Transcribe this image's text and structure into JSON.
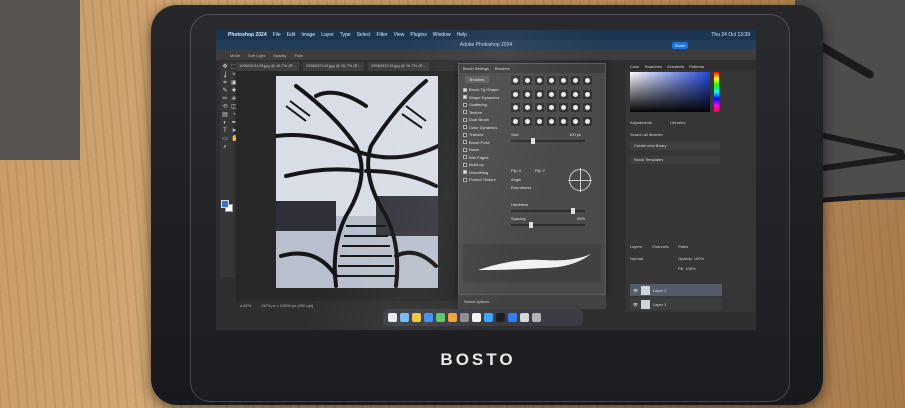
{
  "tablet": {
    "brand": "BOSTO"
  },
  "menubar": {
    "items": [
      "Photoshop 2024",
      "File",
      "Edit",
      "Image",
      "Layer",
      "Type",
      "Select",
      "Filter",
      "View",
      "Plugins",
      "Window",
      "Help"
    ],
    "clock": "Thu 24 Oct 13:39"
  },
  "window": {
    "title": "Adobe Photoshop 2024",
    "share_label": "Share"
  },
  "options_bar": {
    "mode_label": "Mode",
    "mode_value": "Soft Light",
    "opacity_label": "Opacity",
    "flow_label": "Flow"
  },
  "documents": {
    "tabs": [
      "19960321143.jpg @ 16.7% (R...",
      "1996032143.jpg @ 16.7% (R...",
      "1996032143.jpg @ 16.7% (R..."
    ]
  },
  "status": {
    "zoom": "4.82%",
    "info": "2673 px x 13000 px (300 ppi)"
  },
  "brush_settings": {
    "tabs": [
      "Brush Settings",
      "Brushes"
    ],
    "subtab": "Brushes",
    "options": [
      {
        "label": "Brush Tip Shape",
        "on": true
      },
      {
        "label": "Shape Dynamics",
        "on": true
      },
      {
        "label": "Scattering",
        "on": false
      },
      {
        "label": "Texture",
        "on": false
      },
      {
        "label": "Dual Brush",
        "on": false
      },
      {
        "label": "Color Dynamics",
        "on": false
      },
      {
        "label": "Transfer",
        "on": false
      },
      {
        "label": "Brush Pose",
        "on": false
      },
      {
        "label": "Noise",
        "on": false
      },
      {
        "label": "Wet Edges",
        "on": false
      },
      {
        "label": "Build-up",
        "on": false
      },
      {
        "label": "Smoothing",
        "on": true
      },
      {
        "label": "Protect Texture",
        "on": false
      }
    ],
    "size": "100 px",
    "flip_x": "Flip X",
    "flip_y": "Flip Y",
    "angle_label": "Angle",
    "roundness_label": "Roundness",
    "hardness_label": "Hardness",
    "spacing_label": "Spacing",
    "spacing_value": "25%",
    "footer": "Select options"
  },
  "right_panel": {
    "tabs": [
      "Color",
      "Swatches",
      "Gradients",
      "Patterns"
    ],
    "adj_tabs": [
      "Adjustments",
      "Libraries"
    ],
    "search_placeholder": "Search all libraries",
    "create_label": "Create new library",
    "stock_label": "Stock Templates",
    "layers_tabs": [
      "Layers",
      "Channels",
      "Paths"
    ],
    "kind_label": "Normal",
    "opacity_label": "Opacity: 100%",
    "fill_label": "Fill: 100%",
    "layers": [
      {
        "name": "Layer 2",
        "selected": true
      },
      {
        "name": "Layer 1",
        "selected": false
      }
    ]
  },
  "colors": {
    "accent": "#1473e6",
    "menubar": "#18324e",
    "foreground": "#2e6fd6"
  },
  "toolbar_icons": [
    "move-icon",
    "marquee-icon",
    "lasso-icon",
    "magic-wand-icon",
    "crop-icon",
    "frame-icon",
    "eyedropper-icon",
    "healing-icon",
    "brush-icon",
    "clone-stamp-icon",
    "history-brush-icon",
    "eraser-icon",
    "gradient-icon",
    "blur-icon",
    "dodge-icon",
    "pen-icon",
    "type-icon",
    "path-select-icon",
    "shape-icon",
    "hand-icon",
    "zoom-icon"
  ]
}
